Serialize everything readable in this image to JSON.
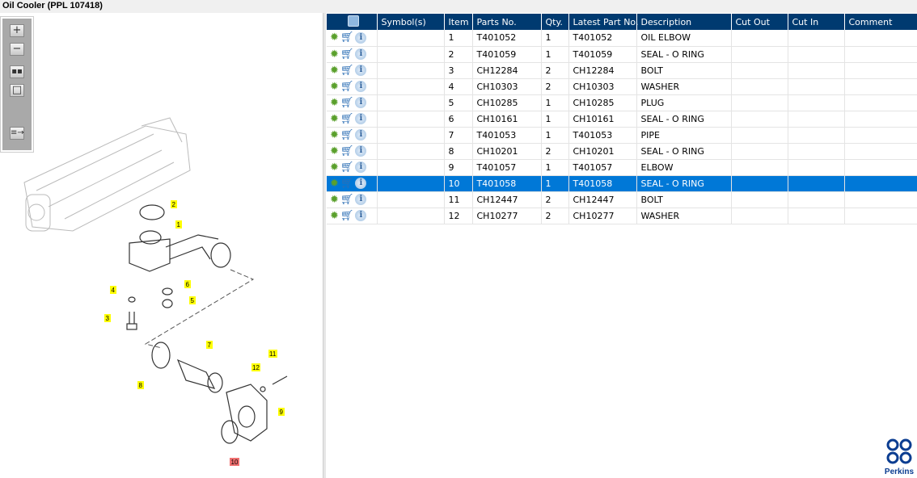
{
  "title": "Oil Cooler (PPL 107418)",
  "toolbar": {
    "zoom_in": "zoom-in",
    "zoom_out": "zoom-out",
    "fit": "fit-all",
    "actual": "actual-size",
    "layout": "toggle-layout"
  },
  "table": {
    "headers": [
      "",
      "Symbol(s)",
      "Item",
      "Parts No.",
      "Qty.",
      "Latest Part No.",
      "Description",
      "Cut Out",
      "Cut In",
      "Comment"
    ],
    "rows": [
      {
        "item": "1",
        "part": "T401052",
        "qty": "1",
        "latest": "T401052",
        "desc": "OIL ELBOW"
      },
      {
        "item": "2",
        "part": "T401059",
        "qty": "1",
        "latest": "T401059",
        "desc": "SEAL - O RING"
      },
      {
        "item": "3",
        "part": "CH12284",
        "qty": "2",
        "latest": "CH12284",
        "desc": "BOLT"
      },
      {
        "item": "4",
        "part": "CH10303",
        "qty": "2",
        "latest": "CH10303",
        "desc": "WASHER"
      },
      {
        "item": "5",
        "part": "CH10285",
        "qty": "1",
        "latest": "CH10285",
        "desc": "PLUG"
      },
      {
        "item": "6",
        "part": "CH10161",
        "qty": "1",
        "latest": "CH10161",
        "desc": "SEAL - O RING"
      },
      {
        "item": "7",
        "part": "T401053",
        "qty": "1",
        "latest": "T401053",
        "desc": "PIPE"
      },
      {
        "item": "8",
        "part": "CH10201",
        "qty": "2",
        "latest": "CH10201",
        "desc": "SEAL - O RING"
      },
      {
        "item": "9",
        "part": "T401057",
        "qty": "1",
        "latest": "T401057",
        "desc": "ELBOW"
      },
      {
        "item": "10",
        "part": "T401058",
        "qty": "1",
        "latest": "T401058",
        "desc": "SEAL - O RING",
        "selected": true
      },
      {
        "item": "11",
        "part": "CH12447",
        "qty": "2",
        "latest": "CH12447",
        "desc": "BOLT"
      },
      {
        "item": "12",
        "part": "CH10277",
        "qty": "2",
        "latest": "CH10277",
        "desc": "WASHER"
      }
    ]
  },
  "callouts": [
    "1",
    "2",
    "3",
    "4",
    "5",
    "6",
    "7",
    "8",
    "9",
    "10",
    "11",
    "12"
  ],
  "logo": "Perkins",
  "colors": {
    "header": "#003a70",
    "selected": "#0078d7",
    "callout": "#ffff00",
    "callout_selected": "#f07070"
  }
}
